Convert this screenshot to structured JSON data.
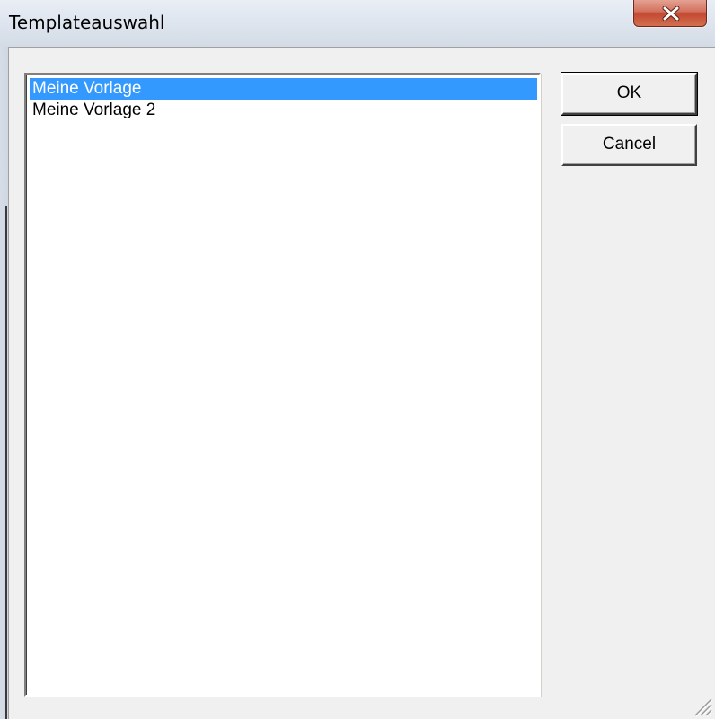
{
  "window": {
    "title": "Templateauswahl"
  },
  "list": {
    "items": [
      {
        "label": "Meine Vorlage",
        "selected": true
      },
      {
        "label": "Meine Vorlage 2",
        "selected": false
      }
    ]
  },
  "buttons": {
    "ok_label": "OK",
    "cancel_label": "Cancel"
  },
  "colors": {
    "selection": "#3399ff",
    "close_button": "#c44a33"
  },
  "icons": {
    "close": "close-icon",
    "resize": "resize-grip-icon"
  }
}
